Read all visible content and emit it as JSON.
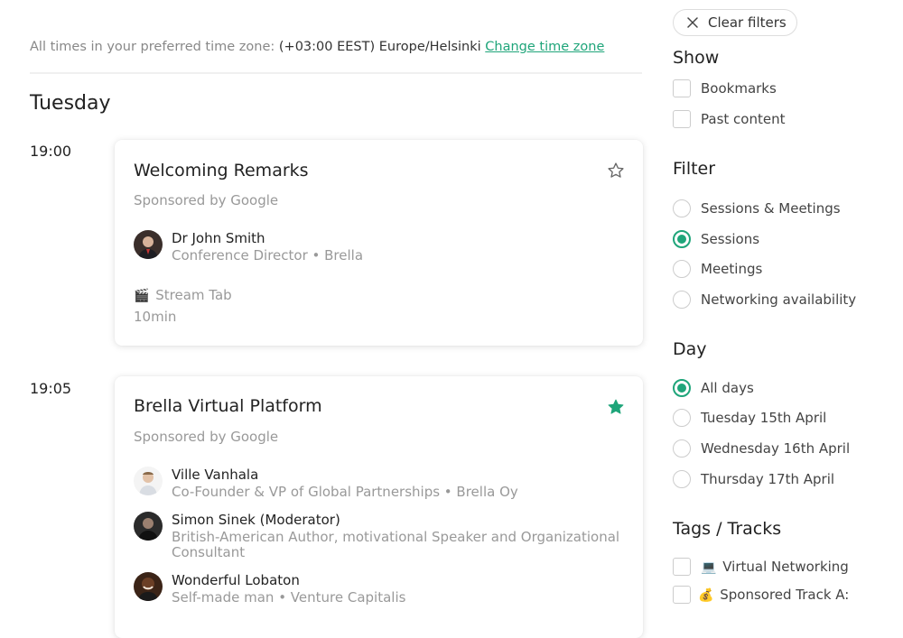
{
  "timezone": {
    "prefix": "All times in your preferred time zone:",
    "value": "(+03:00 EEST) Europe/Helsinki",
    "change_link": "Change time zone"
  },
  "day_heading": "Tuesday",
  "sessions": [
    {
      "time": "19:00",
      "title": "Welcoming Remarks",
      "sponsor": "Sponsored by Google",
      "bookmarked": false,
      "speakers": [
        {
          "name": "Dr John Smith",
          "role": "Conference Director • Brella"
        }
      ],
      "stream_icon": "🎬",
      "stream": "Stream Tab",
      "duration": "10min"
    },
    {
      "time": "19:05",
      "title": "Brella Virtual Platform",
      "sponsor": "Sponsored by Google",
      "bookmarked": true,
      "speakers": [
        {
          "name": "Ville Vanhala",
          "role": "Co-Founder & VP of Global Partnerships • Brella Oy"
        },
        {
          "name": "Simon Sinek (Moderator)",
          "role": "British-American Author, motivational Speaker and Organizational Consultant"
        },
        {
          "name": "Wonderful Lobaton",
          "role": "Self-made man • Venture Capitalis"
        }
      ]
    }
  ],
  "sidebar": {
    "clear_filters": "Clear filters",
    "show": {
      "heading": "Show",
      "options": [
        {
          "label": "Bookmarks",
          "checked": false
        },
        {
          "label": "Past content",
          "checked": false
        }
      ]
    },
    "filter": {
      "heading": "Filter",
      "options": [
        {
          "label": "Sessions & Meetings",
          "selected": false
        },
        {
          "label": "Sessions",
          "selected": true
        },
        {
          "label": "Meetings",
          "selected": false
        },
        {
          "label": "Networking availability",
          "selected": false
        }
      ]
    },
    "day": {
      "heading": "Day",
      "options": [
        {
          "label": "All days",
          "selected": true
        },
        {
          "label": "Tuesday 15th April",
          "selected": false
        },
        {
          "label": "Wednesday 16th April",
          "selected": false
        },
        {
          "label": "Thursday 17th April",
          "selected": false
        }
      ]
    },
    "tags": {
      "heading": "Tags / Tracks",
      "options": [
        {
          "emoji": "💻",
          "label": "Virtual Networking",
          "checked": false
        },
        {
          "emoji": "💰",
          "label": "Sponsored Track A:",
          "checked": false
        }
      ]
    }
  },
  "colors": {
    "accent": "#1fa57a",
    "muted": "#999999"
  },
  "icons": {
    "clear": "close-icon",
    "bookmark_empty": "star-outline-icon",
    "bookmark_filled": "star-filled-icon"
  }
}
